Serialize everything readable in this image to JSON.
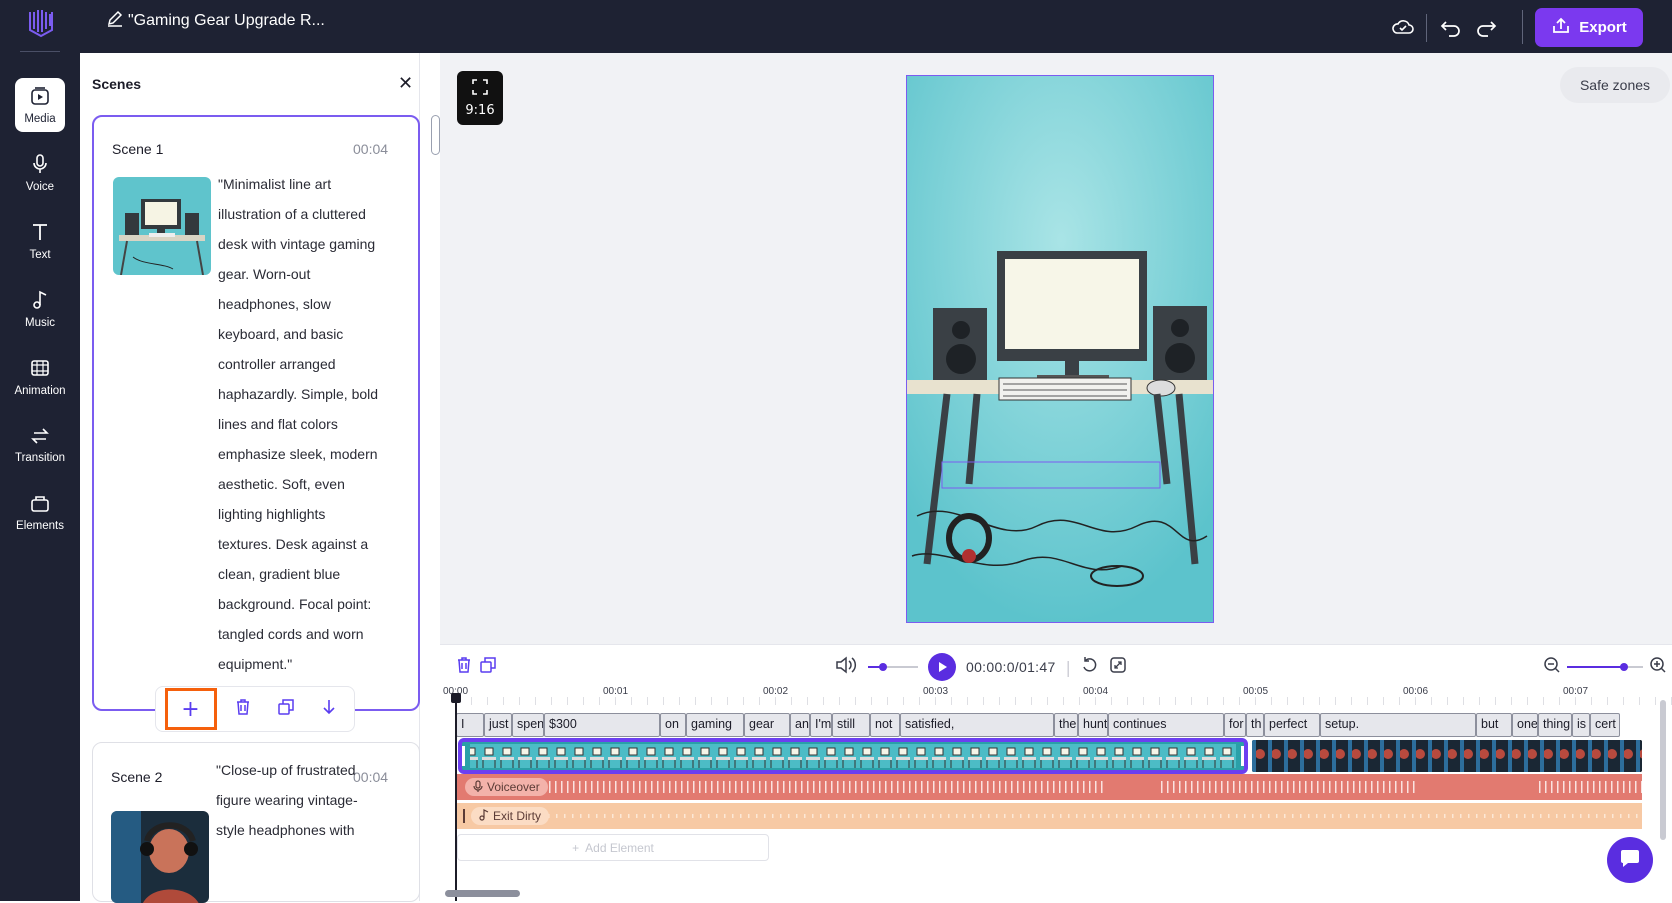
{
  "app": {
    "project_title": "\"Gaming Gear Upgrade R...",
    "export_label": "Export",
    "icons": {
      "logo": "logo-icon",
      "edit": "pencil-icon",
      "cloud": "cloud-sync-icon",
      "undo": "undo-icon",
      "redo": "redo-icon",
      "export": "export-icon"
    }
  },
  "sidebar": {
    "items": [
      {
        "label": "Media",
        "icon": "media-icon"
      },
      {
        "label": "Voice",
        "icon": "microphone-icon"
      },
      {
        "label": "Text",
        "icon": "text-icon"
      },
      {
        "label": "Music",
        "icon": "music-note-icon"
      },
      {
        "label": "Animation",
        "icon": "animation-icon"
      },
      {
        "label": "Transition",
        "icon": "transition-icon"
      },
      {
        "label": "Elements",
        "icon": "elements-icon"
      }
    ]
  },
  "scenes_panel": {
    "title": "Scenes",
    "scenes": [
      {
        "name": "Scene 1",
        "duration": "00:04",
        "description_lines": [
          "\"Minimalist line art",
          "illustration of a cluttered",
          "desk with vintage gaming",
          "gear. Worn-out",
          "headphones, slow",
          "keyboard, and basic",
          "controller arranged",
          "haphazardly. Simple, bold",
          "lines and flat colors",
          "emphasize sleek, modern",
          "aesthetic. Soft, even",
          "lighting highlights",
          "textures. Desk against a",
          "clean, gradient blue",
          "background. Focal point:",
          "tangled cords and worn",
          "equipment.\""
        ]
      },
      {
        "name": "Scene 2",
        "duration": "00:04",
        "description_lines": [
          "\"Close-up of frustrated",
          "figure wearing vintage-",
          "style headphones with"
        ]
      }
    ],
    "scene_tools": {
      "add": "+",
      "icons": [
        "plus-icon",
        "trash-icon",
        "duplicate-icon",
        "arrow-down-icon"
      ]
    }
  },
  "canvas": {
    "aspect_ratio": "9:16",
    "safe_zones_label": "Safe zones"
  },
  "timeline": {
    "current_time": "00:00:0/01:47",
    "volume_level": 0.3,
    "zoom_level": 0.75,
    "ticks": [
      "00:00",
      "00:01",
      "00:02",
      "00:03",
      "00:04",
      "00:05",
      "00:06",
      "00:07"
    ],
    "words": [
      {
        "t": "I",
        "w": 28
      },
      {
        "t": "just",
        "w": 28
      },
      {
        "t": "spent",
        "w": 32
      },
      {
        "t": "$300",
        "w": 116
      },
      {
        "t": "on",
        "w": 26
      },
      {
        "t": "gaming",
        "w": 58
      },
      {
        "t": "gear",
        "w": 46
      },
      {
        "t": "an",
        "w": 20
      },
      {
        "t": "I'm",
        "w": 22
      },
      {
        "t": "still",
        "w": 38
      },
      {
        "t": "not",
        "w": 30
      },
      {
        "t": "satisfied,",
        "w": 154
      },
      {
        "t": "the",
        "w": 24
      },
      {
        "t": "hunt",
        "w": 30
      },
      {
        "t": "continues",
        "w": 116
      },
      {
        "t": "for",
        "w": 22
      },
      {
        "t": "th",
        "w": 18
      },
      {
        "t": "perfect",
        "w": 56
      },
      {
        "t": "setup.",
        "w": 156
      },
      {
        "t": "but",
        "w": 36
      },
      {
        "t": "one",
        "w": 26
      },
      {
        "t": "thing",
        "w": 34
      },
      {
        "t": "is",
        "w": 18
      },
      {
        "t": "cert",
        "w": 30
      }
    ],
    "voiceover_label": "Voiceover",
    "music_label": "Exit Dirty",
    "add_element_label": "Add Element"
  }
}
